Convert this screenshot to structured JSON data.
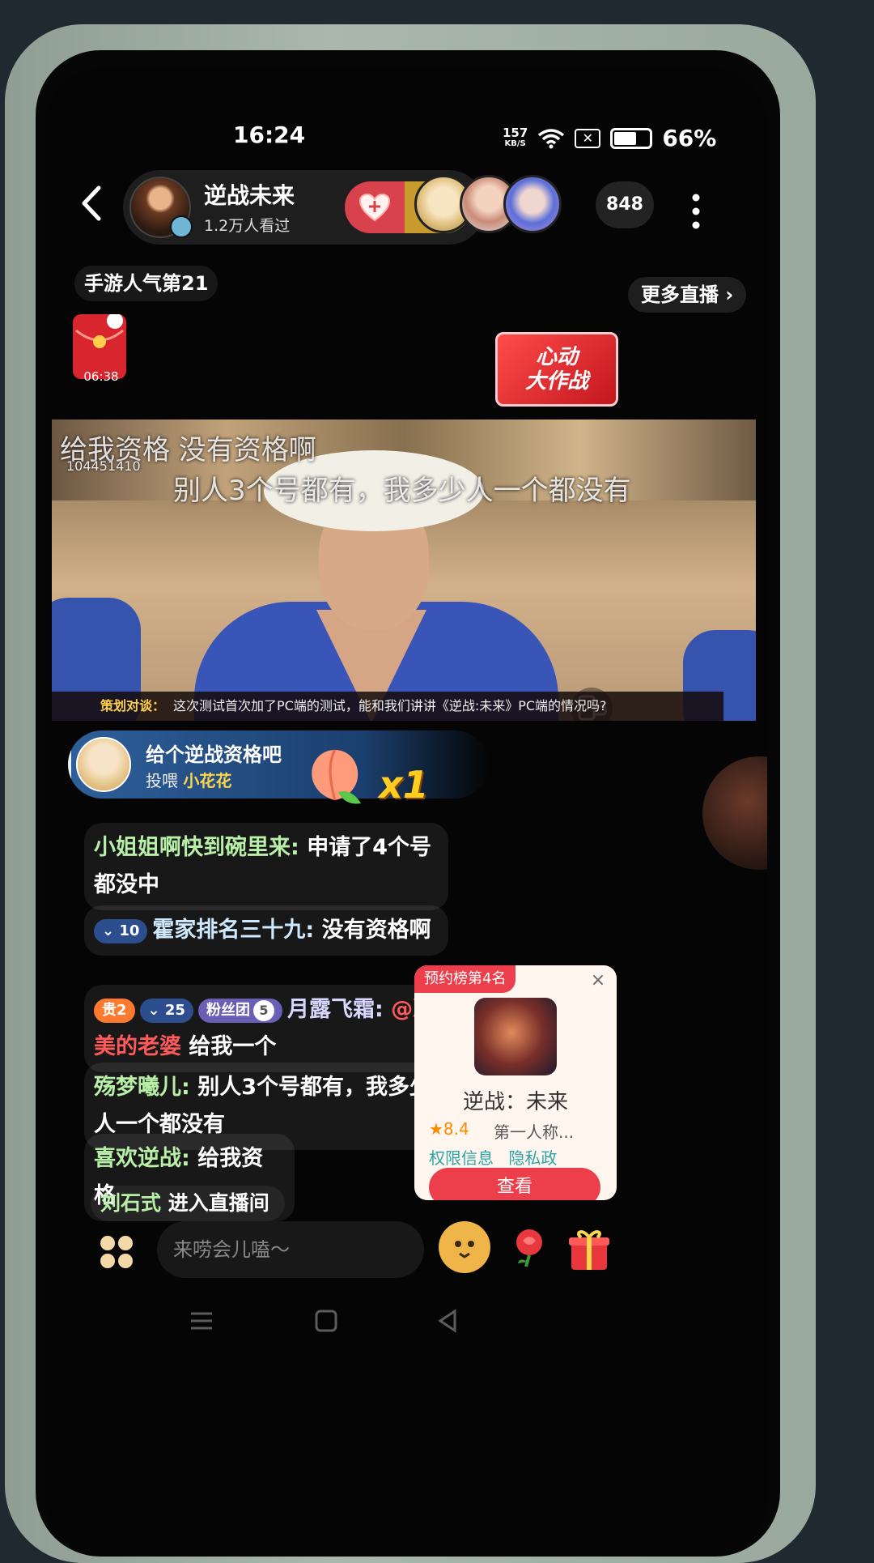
{
  "status_bar": {
    "time": "16:24",
    "net_speed_value": "157",
    "net_speed_unit": "KB/S",
    "sim_label": "✕",
    "battery_percent": "66%",
    "battery_level": 0.66
  },
  "header": {
    "host_name": "逆战未来",
    "viewers": "1.2万人看过",
    "viewer_count": "848",
    "rank_tag": "手游人气第21",
    "more_live": "更多直播 ›"
  },
  "widgets": {
    "red_packet_timer": "06:38",
    "event_banner_line1": "心动",
    "event_banner_line2": "大作战"
  },
  "video": {
    "caption_1": "给我资格  没有资格啊",
    "caption_2": "别人3个号都有，我多少人一个都没有",
    "viewer_id": "104451410",
    "topic_label": "策划对谈：",
    "topic_text": "这次测试首次加了PC端的测试，能和我们讲讲《逆战:未来》PC端的情况吗?"
  },
  "gift": {
    "title": "给个逆战资格吧",
    "action": "投喂",
    "gift_name": "小花花",
    "multiplier": "x1"
  },
  "chat": {
    "messages": [
      {
        "user": "小姐姐啊快到碗里来:",
        "text": " 申请了4个号都没中"
      },
      {
        "level": "10",
        "user": "霍家排名三十九:",
        "text": " 没有资格啊"
      },
      {
        "vip": "贵2",
        "level": "25",
        "fans_label": "粉丝团",
        "fans_level": "5",
        "user": "月露飞霜:",
        "mention": " @凌美的老婆",
        "text": " 给我一个"
      },
      {
        "user": "殇梦曦儿:",
        "text": " 别人3个号都有，我多少人一个都没有"
      },
      {
        "user": "喜欢逆战:",
        "text": " 给我资格"
      }
    ],
    "enter_user": "刘石式",
    "enter_text": " 进入直播间"
  },
  "reservation": {
    "tag": "预约榜第4名",
    "close": "×",
    "game_name": "逆战：未来",
    "rating": "★8.4",
    "genre": "第一人称...",
    "link_1": "权限信息",
    "link_2": "隐私政",
    "button": "查看"
  },
  "bottom_bar": {
    "input_placeholder": "来唠会儿嗑～"
  },
  "colors": {
    "accent_red": "#ec3e4b",
    "gold": "#ffcc22",
    "chat_user_green": "#b9f0a8"
  }
}
